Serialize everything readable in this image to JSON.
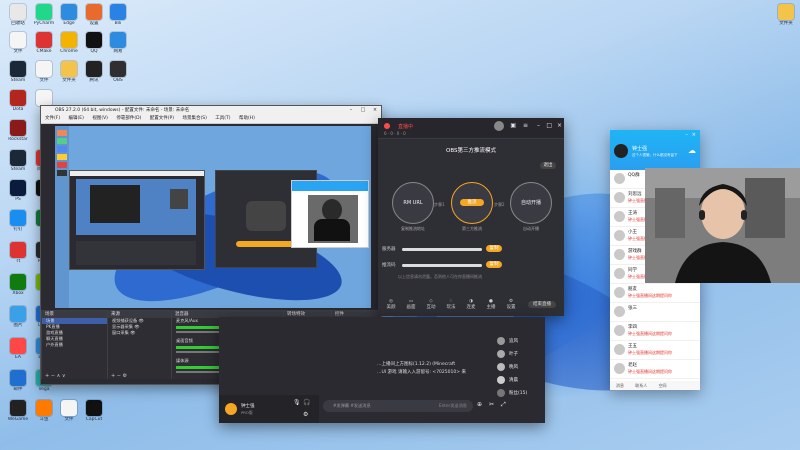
{
  "desktop": {
    "icons": [
      {
        "label": "回收站",
        "color": "#e8e8e8"
      },
      {
        "label": "PyCharm",
        "color": "#21d789"
      },
      {
        "label": "Edge",
        "color": "#2d8be0"
      },
      {
        "label": "设置",
        "color": "#e86a2c"
      },
      {
        "label": "Bili",
        "color": "#2a82e4"
      },
      {
        "label": "文件",
        "color": "#f5f5f5"
      },
      {
        "label": "CMake",
        "color": "#d33"
      },
      {
        "label": "Chrome",
        "color": "#f2b400"
      },
      {
        "label": "QQ",
        "color": "#111"
      },
      {
        "label": "网易",
        "color": "#2d8be0"
      },
      {
        "label": "Steam",
        "color": "#1b2838"
      },
      {
        "label": "文件",
        "color": "#f5f5f5"
      },
      {
        "label": "文件夹",
        "color": "#f3c34a"
      },
      {
        "label": "腾讯",
        "color": "#222"
      },
      {
        "label": "OBS",
        "color": "#302e31"
      },
      {
        "label": "Dota",
        "color": "#b3261e"
      },
      {
        "label": "文件",
        "color": "#f5f5f5"
      },
      {
        "label": "Rockstar",
        "color": "#8b1a1a"
      },
      {
        "label": "Steam",
        "color": "#1b2838"
      },
      {
        "label": "网易云",
        "color": "#d33"
      },
      {
        "label": "PS",
        "color": "#0a1b3d"
      },
      {
        "label": "剪映",
        "color": "#111"
      },
      {
        "label": "钉钉",
        "color": "#1a8ef0"
      },
      {
        "label": "工具",
        "color": "#117a3a"
      },
      {
        "label": "Tt",
        "color": "#d33"
      },
      {
        "label": "PUBG",
        "color": "#2a2a2a"
      },
      {
        "label": "Xbox",
        "color": "#107c10"
      },
      {
        "label": "NV",
        "color": "#76b900"
      },
      {
        "label": "图片",
        "color": "#3aa0e8"
      },
      {
        "label": "Uplay",
        "color": "#1e6fd9"
      },
      {
        "label": "EA",
        "color": "#ff4747"
      },
      {
        "label": "Edge",
        "color": "#2d8be0"
      },
      {
        "label": "邮件",
        "color": "#1f6fd1"
      },
      {
        "label": "Vega",
        "color": "#20b2aa"
      },
      {
        "label": "WeGame",
        "color": "#222"
      },
      {
        "label": "斗鱼",
        "color": "#ff7a00"
      },
      {
        "label": "文件",
        "color": "#f5f5f5"
      },
      {
        "label": "CapCut",
        "color": "#111"
      }
    ],
    "corner_folder": "文件夹"
  },
  "obs": {
    "title": "OBS 27.2.0 (64 bit, windows) - 配置文件: 未命名 - 场景: 未命名",
    "menu": [
      "文件(F)",
      "编辑(E)",
      "视图(V)",
      "停靠部件(D)",
      "配置文件(P)",
      "场景集合(S)",
      "工具(T)",
      "帮助(H)"
    ],
    "docks": {
      "scenes": {
        "title": "场景",
        "items": [
          "场景",
          "PK直播",
          "游戏直播",
          "聊天直播",
          "户外直播"
        ]
      },
      "sources": {
        "title": "来源",
        "items": [
          "视频捕获设备",
          "显示器采集",
          "窗口采集"
        ]
      },
      "mixer": {
        "title": "混音器",
        "channels": [
          "麦克风/Aux",
          "桌面音频",
          "媒体源"
        ],
        "level": "0.0 dB"
      },
      "transitions": {
        "title": "转场特效",
        "selected": "淡入淡出",
        "duration_label": "时长",
        "duration": "300 ms"
      },
      "controls": {
        "title": "控件",
        "buttons": [
          "开始推流",
          "开始录制",
          "启动虚拟摄像机",
          "工作室模式",
          "设置",
          "退出"
        ]
      }
    },
    "status": "LIVE: 00:00:00  REC: 00:00:00  CPU: 3.2%, 30.00 fps"
  },
  "live": {
    "title_badge": "直播中",
    "mode_title": "OBS第三方推流模式",
    "exit_btn": "退出",
    "modes": [
      "RM URL",
      "推流",
      "自动开播"
    ],
    "mode_notes": [
      "复制推流地址",
      "第三方推流",
      "自动开播"
    ],
    "step_labels": [
      "步骤1",
      "步骤2"
    ],
    "copy_btn": "复制",
    "row_labels": [
      "服务器",
      "推流码"
    ],
    "warning": "以上信息请勿泄露，否则他人可在你直播间推流",
    "toolbar": [
      "美颜",
      "画面",
      "互动",
      "玩法",
      "连麦",
      "主播",
      "设置"
    ],
    "stats": [
      "0",
      "0",
      "0",
      "0"
    ],
    "end_btn": "结束直播"
  },
  "chat": {
    "messages": [
      "…上播间上方图标(1.12.2) (Minecraft",
      "…UI 游戏 请输入入游留号: <7025010>  来"
    ],
    "viewers": [
      {
        "name": "追风",
        "role": "管理"
      },
      {
        "name": "叶子",
        "role": ""
      },
      {
        "name": "晚风",
        "role": ""
      },
      {
        "name": "清晨",
        "role": ""
      },
      {
        "name": "粉丝(15)",
        "role": ""
      }
    ],
    "host": {
      "name": "钟士强",
      "sub": "PRO版"
    },
    "input_placeholder": "#发弹幕 #发送消息",
    "enter_hint": "Enter发送消息"
  },
  "qq": {
    "name": "钟士强",
    "signature": "这个人很懒，什么都没有留下",
    "tabs": [
      "消息",
      "联系人",
      "空间"
    ],
    "chats": [
      {
        "name": "QQ群",
        "msg": "",
        "count": "3"
      },
      {
        "name": "刘思远",
        "msg": "钟士强直播间这期提问你",
        "count": "1"
      },
      {
        "name": "王涛",
        "msg": "钟士强直播间这期提问你",
        "count": ""
      },
      {
        "name": "小王",
        "msg": "钟士强直播间这期提问你",
        "count": ""
      },
      {
        "name": "游戏群",
        "msg": "钟士强直播间这期提问你",
        "count": ""
      },
      {
        "name": "同学",
        "msg": "钟士强直播间这期提问你",
        "count": ""
      },
      {
        "name": "朋友",
        "msg": "钟士强直播间这期提问你",
        "count": ""
      },
      {
        "name": "张三",
        "msg": "",
        "count": ""
      },
      {
        "name": "李四",
        "msg": "钟士强直播间这期提问你",
        "count": ""
      },
      {
        "name": "王五",
        "msg": "钟士强直播间这期提问你",
        "count": ""
      },
      {
        "name": "老赵",
        "msg": "钟士强直播间这期提问你",
        "count": ""
      },
      {
        "name": "小明",
        "msg": "钟士强直播间这期提问你",
        "count": ""
      },
      {
        "name": "阿强",
        "msg": "钟士强直播间这期提问你",
        "count": ""
      }
    ]
  }
}
